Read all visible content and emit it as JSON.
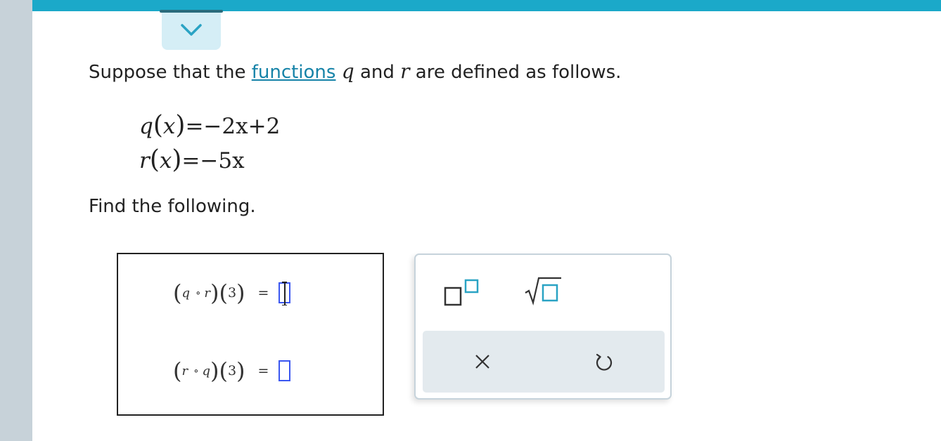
{
  "intro": {
    "prefix": "Suppose that the",
    "link": "functions",
    "f1": "q",
    "and": "and",
    "f2": "r",
    "suffix": "are defined as follows."
  },
  "definitions": [
    {
      "name": "q",
      "var": "x",
      "rhs": "=−2x+2"
    },
    {
      "name": "r",
      "var": "x",
      "rhs": "=−5x"
    }
  ],
  "find_text": "Find the following.",
  "answers": [
    {
      "outer": "q",
      "circle": "∘",
      "inner": "r",
      "arg": "3",
      "equals": "=",
      "value": ""
    },
    {
      "outer": "r",
      "circle": "∘",
      "inner": "q",
      "arg": "3",
      "equals": "=",
      "value": ""
    }
  ],
  "colors": {
    "accent": "#1ba9c9",
    "link": "#1683a8",
    "icon": "#2aa3c4",
    "slot": "#3b57f0"
  },
  "icons": [
    "chevron-down-icon",
    "superscript-icon",
    "square-root-icon",
    "clear-icon",
    "undo-icon"
  ]
}
